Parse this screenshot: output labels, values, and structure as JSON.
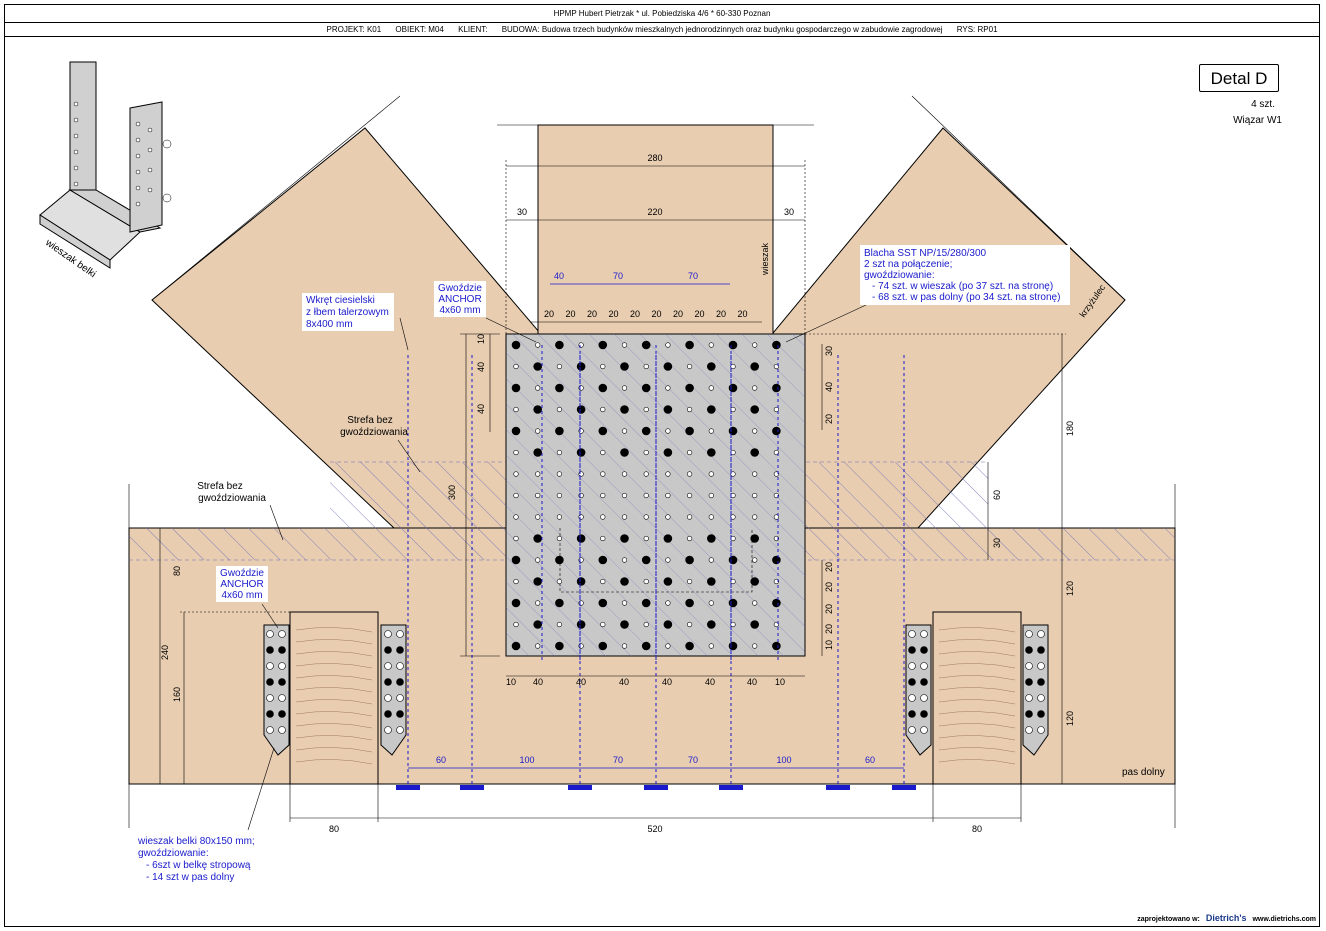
{
  "header": {
    "line1": "HPMP Hubert Pietrzak * ul. Pobiedziska 4/6 * 60-330 Poznan",
    "projekt": "PROJEKT: K01",
    "obiekt": "OBIEKT: M04",
    "klient": "KLIENT:",
    "budowa": "BUDOWA: Budowa trzech budynków mieszkalnych jednorodzinnych oraz budynku gospodarczego w zabudowie zagrodowej",
    "rys": "RYS: RP01"
  },
  "detail": {
    "title": "Detal D",
    "count": "4 szt.",
    "truss": "Wiązar W1"
  },
  "labels": {
    "wieszak_belki": "wieszak belki",
    "wieszak": "wieszak",
    "krzyzulec": "krzyżulec",
    "pas_dolny": "pas dolny",
    "wkret": [
      "Wkręt ciesielski",
      "z łbem talerzowym",
      "8x400 mm"
    ],
    "gwozdzie_top": [
      "Gwoździe",
      "ANCHOR",
      "4x60 mm"
    ],
    "gwozdzie_left": [
      "Gwoździe",
      "ANCHOR",
      "4x60 mm"
    ],
    "strefa1": [
      "Strefa bez",
      "gwoździowania"
    ],
    "strefa2": [
      "Strefa bez",
      "gwoździowania"
    ],
    "blacha": [
      "Blacha SST NP/15/280/300",
      "2 szt na połączenie;",
      "gwoździowanie:",
      "- 74 szt. w wieszak (po 37 szt. na stronę)",
      "- 68 szt. w pas dolny (po 34 szt. na stronę)"
    ],
    "wieszak_note": [
      "wieszak belki 80x150 mm;",
      "gwoździowanie:",
      "- 6szt w belkę stropową",
      "- 14 szt w pas dolny"
    ]
  },
  "dimensions": {
    "top_280": "280",
    "top_30a": "30",
    "top_220": "220",
    "top_30b": "30",
    "screw_40": "40",
    "screw_70a": "70",
    "screw_70b": "70",
    "nail_20s": [
      "20",
      "20",
      "20",
      "20",
      "20",
      "20",
      "20",
      "20",
      "20",
      "20"
    ],
    "left_10": "10",
    "left_40a": "40",
    "left_40b": "40",
    "left_300": "300",
    "right_30": "30",
    "right_40": "40",
    "right_20": "20",
    "right_180": "180",
    "right_60": "60",
    "right_30b": "30",
    "right_120a": "120",
    "right_120b": "120",
    "low_20s": [
      "20",
      "20",
      "20",
      "20",
      "10"
    ],
    "bottom_plate": [
      "10",
      "40",
      "40",
      "40",
      "40",
      "40",
      "40",
      "10"
    ],
    "left_80": "80",
    "left_240": "240",
    "left_160": "160",
    "bottom_screw": [
      "60",
      "100",
      "70",
      "70",
      "100",
      "60"
    ],
    "base_80a": "80",
    "base_520": "520",
    "base_80b": "80"
  },
  "footer": {
    "prefix": "zaprojektowano w:",
    "brand": "Dietrich's",
    "url": "www.dietrichs.com"
  },
  "colors": {
    "wood": "#e8cdb0",
    "plate": "#c8c8c8",
    "blue": "#1a1acc",
    "hatch": "#6a6ab8"
  }
}
